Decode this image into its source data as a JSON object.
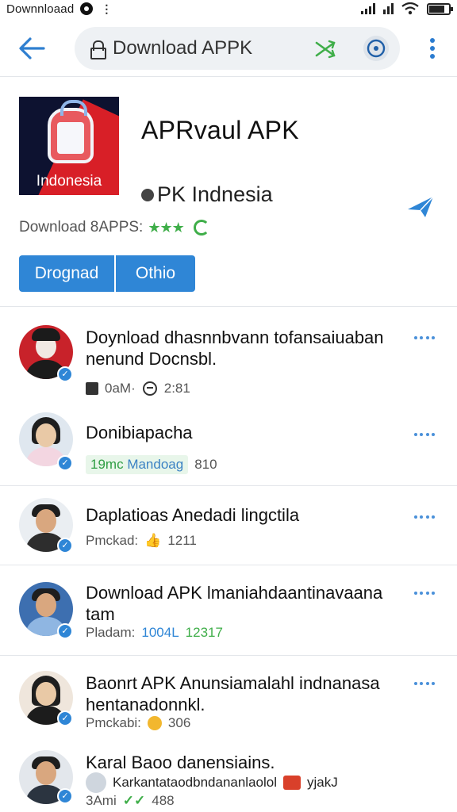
{
  "status": {
    "title": "Downnloaad"
  },
  "toolbar": {
    "search_value": "Download APPK"
  },
  "app": {
    "icon_label": "Indonesia",
    "title": "APRvaul APK",
    "subtitle": "PK Indnesia",
    "download_text": "Download 8APPS:",
    "stars": "★★★",
    "button_primary": "Drognad",
    "button_secondary": "Othio"
  },
  "items": [
    {
      "title": "Doynload dhasnnbvann tofansaiuaban nenund Docnsbl.",
      "meta_a": "0aM·",
      "meta_b": "2:81"
    },
    {
      "title": "Donibiapacha",
      "meta_a": "19mc",
      "meta_b": "Mandoag",
      "meta_c": "810"
    },
    {
      "title": "Daplatioas Anedadi lingctila",
      "meta_a": "Pmckad:",
      "meta_b": "1211"
    },
    {
      "title": "Download APK lmaniahdaantinavaana tam",
      "meta_a": "Pladam:",
      "meta_b": "1004L",
      "meta_c": "12317"
    },
    {
      "title": "Baonrt APK Anunsiamalahl indnanasa hentanadonnkl.",
      "meta_a": "Pmckabi:",
      "meta_b": "306"
    },
    {
      "title": "Karal Baoo danensiains.",
      "sub": "Karkantataodbndananlaolol",
      "sub_end": "yjakJ",
      "meta_a": "3Ami",
      "meta_b": "488"
    }
  ],
  "colors": {
    "accent": "#2f86d6",
    "green": "#3fae49"
  }
}
